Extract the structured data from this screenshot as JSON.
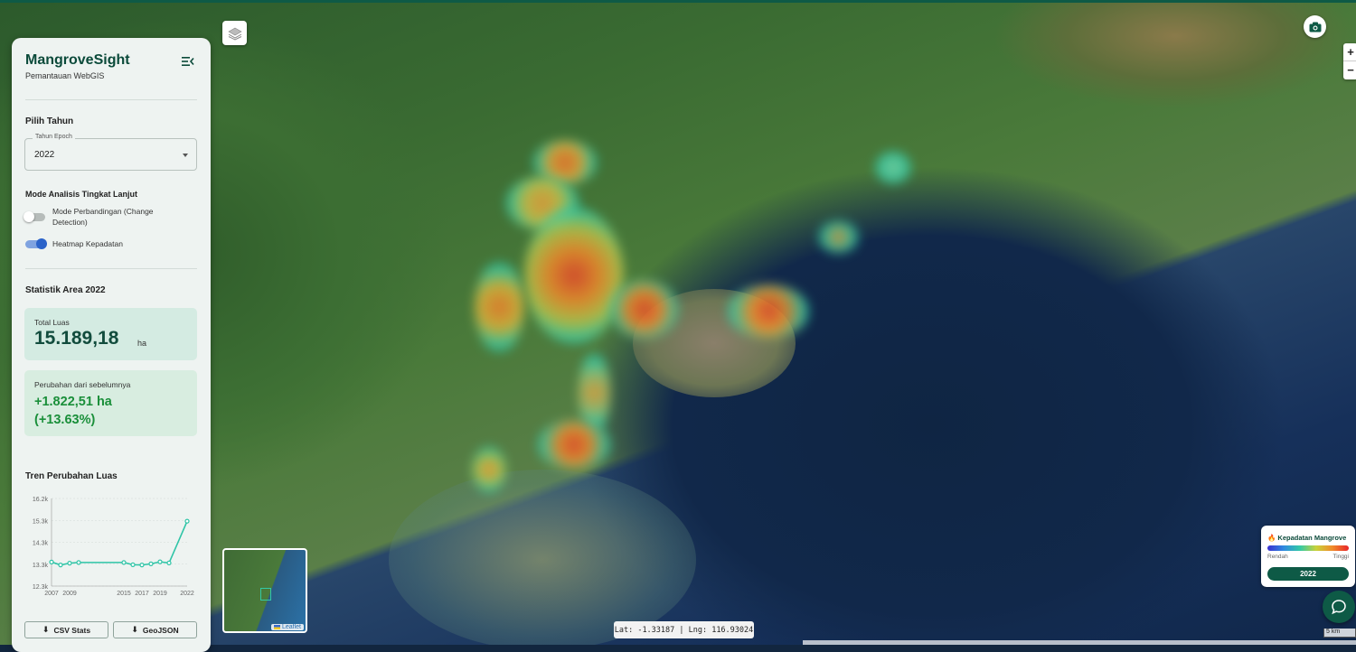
{
  "sidebar": {
    "app_title": "MangroveSight",
    "app_subtitle": "Pemantauan WebGIS",
    "year_section_title": "Pilih Tahun",
    "year_select_label": "Tahun Epoch",
    "year_select_value": "2022",
    "advanced_title": "Mode Analisis Tingkat Lanjut",
    "toggle_change_label": "Mode Perbandingan (Change Detection)",
    "toggle_change_on": false,
    "toggle_heatmap_label": "Heatmap Kepadatan",
    "toggle_heatmap_on": true,
    "stats_title": "Statistik Area 2022",
    "total_label": "Total Luas",
    "total_value": "15.189,18",
    "total_unit": "ha",
    "change_label": "Perubahan dari sebelumnya",
    "change_value": "+1.822,51 ha",
    "change_percent": "(+13.63%)",
    "trend_title": "Tren Perubahan Luas",
    "csv_button": "CSV Stats",
    "geojson_button": "GeoJSON"
  },
  "chart_data": {
    "type": "line",
    "x": [
      2007,
      2008,
      2009,
      2010,
      2015,
      2016,
      2017,
      2018,
      2019,
      2020,
      2022
    ],
    "x_tick_labels": [
      "2007",
      "2009",
      "2015",
      "2017",
      "2019",
      "2022"
    ],
    "y_tick_labels": [
      "16.2k",
      "15.3k",
      "14.3k",
      "13.3k",
      "12.3k"
    ],
    "values": [
      13370,
      13240,
      13320,
      13350,
      13350,
      13250,
      13240,
      13290,
      13380,
      13330,
      15189
    ],
    "ylim": [
      12300,
      16200
    ],
    "grid": true,
    "color": "#2ec4a6"
  },
  "map": {
    "coords_text": "Lat: -1.33187 | Lng: 116.93024",
    "minimap_attribution": "Leaflet",
    "scale_label": "5 km"
  },
  "legend": {
    "title": "🔥 Kepadatan Mangrove",
    "low_label": "Rendah",
    "high_label": "Tinggi",
    "year_badge": "2022"
  },
  "colors": {
    "brand": "#0b4a3a",
    "accent": "#0e5a46",
    "positive": "#1a8f3a",
    "toggle_on": "#2b63c9"
  },
  "icons": {
    "menu": "menu-collapse-icon",
    "layers": "layers-icon",
    "camera": "camera-icon",
    "chat": "chat-icon",
    "download": "download-icon"
  }
}
